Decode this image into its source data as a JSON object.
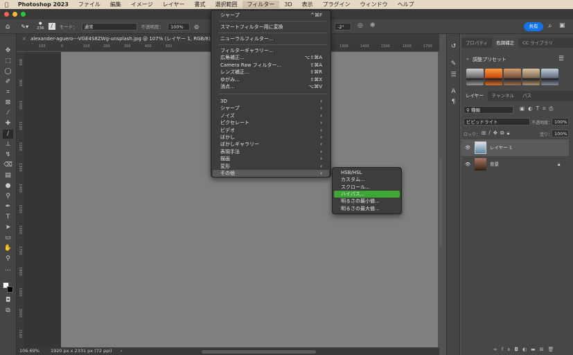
{
  "menubar": {
    "app": "Photoshop 2023",
    "items": [
      "ファイル",
      "編集",
      "イメージ",
      "レイヤー",
      "書式",
      "選択範囲",
      "フィルター",
      "3D",
      "表示",
      "プラグイン",
      "ウィンドウ",
      "ヘルプ"
    ],
    "active": "フィルター"
  },
  "options": {
    "brush_size": "236",
    "mode_label": "モード：",
    "mode_value": "通常",
    "opacity_label": "不透明度：",
    "opacity_value": "100%",
    "angle": "-2°",
    "share": "共有"
  },
  "document": {
    "tab": "alexander-aguero---VGE4S8ZWg-unsplash.jpg @ 107% (レイヤー 1, RGB/8) *"
  },
  "rulers": {
    "h": [
      "100",
      "0",
      "100",
      "200",
      "300",
      "400",
      "500",
      "1300",
      "1400",
      "1500",
      "1600",
      "1700"
    ],
    "v": [
      "800",
      "900",
      "1000",
      "1100",
      "1200",
      "1300",
      "1400",
      "1500",
      "1600",
      "1700",
      "1800",
      "1900",
      "2000",
      "2100"
    ]
  },
  "status": {
    "zoom": "106.69%",
    "info": "1920 px x 2331 px (72 ppi)",
    "arrow": "›"
  },
  "filter_menu": {
    "items": [
      {
        "label": "シャープ",
        "shortcut": "^⌘F"
      },
      {
        "label": "スマートフィルター用に変換"
      },
      {
        "label": "ニューラルフィルター..."
      },
      {
        "label": "フィルターギャラリー..."
      },
      {
        "label": "広角補正...",
        "shortcut": "⌥⇧⌘A"
      },
      {
        "label": "Camera Raw フィルター...",
        "shortcut": "⇧⌘A"
      },
      {
        "label": "レンズ補正...",
        "shortcut": "⇧⌘R"
      },
      {
        "label": "ゆがみ...",
        "shortcut": "⇧⌘X"
      },
      {
        "label": "消点...",
        "shortcut": "⌥⌘V"
      },
      {
        "label": "3D",
        "sub": "›"
      },
      {
        "label": "シャープ",
        "sub": "›"
      },
      {
        "label": "ノイズ",
        "sub": "›"
      },
      {
        "label": "ピクセレート",
        "sub": "›"
      },
      {
        "label": "ビデオ",
        "sub": "›"
      },
      {
        "label": "ぼかし",
        "sub": "›"
      },
      {
        "label": "ぼかしギャラリー",
        "sub": "›"
      },
      {
        "label": "表現手法",
        "sub": "›"
      },
      {
        "label": "描画",
        "sub": "›"
      },
      {
        "label": "変形",
        "sub": "›"
      },
      {
        "label": "その他",
        "sub": "›"
      }
    ]
  },
  "other_submenu": {
    "items": [
      "HSB/HSL",
      "カスタム...",
      "スクロール...",
      "ハイパス...",
      "明るさの最小値...",
      "明るさの最大値..."
    ],
    "highlighted": "ハイパス..."
  },
  "panel": {
    "top_tabs": [
      "プロパティ",
      "色調補正",
      "CC ライブラリ"
    ],
    "top_active": "色調補正",
    "presets_title": "調整プリセット",
    "layer_tabs": [
      "レイヤー",
      "チャンネル",
      "パス"
    ],
    "layer_active": "レイヤー",
    "filter_kind": "種類",
    "blend_mode": "ビビッドライト",
    "opacity_label": "不透明度：",
    "opacity_value": "100%",
    "lock_label": "ロック：",
    "fill_label": "塗り：",
    "fill_value": "100%",
    "layers": [
      {
        "name": "レイヤー 1",
        "selected": true
      },
      {
        "name": "背景",
        "locked": true
      }
    ]
  },
  "colors": {
    "accent": "#1473e6",
    "highlight": "#3fa535",
    "menubar": "#e4d9c4"
  }
}
